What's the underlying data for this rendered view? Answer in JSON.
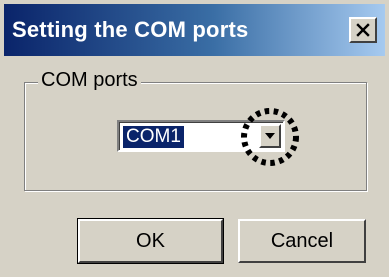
{
  "window": {
    "title": "Setting the COM ports",
    "close_icon": "close-x"
  },
  "group": {
    "label": "COM ports"
  },
  "com_select": {
    "value": "COM1",
    "dropdown_icon": "triangle-down"
  },
  "buttons": {
    "ok_label": "OK",
    "cancel_label": "Cancel"
  },
  "colors": {
    "title_gradient_start": "#0a246a",
    "title_gradient_end": "#a6caf0",
    "face": "#d6d2c6",
    "selection": "#0a246a"
  }
}
